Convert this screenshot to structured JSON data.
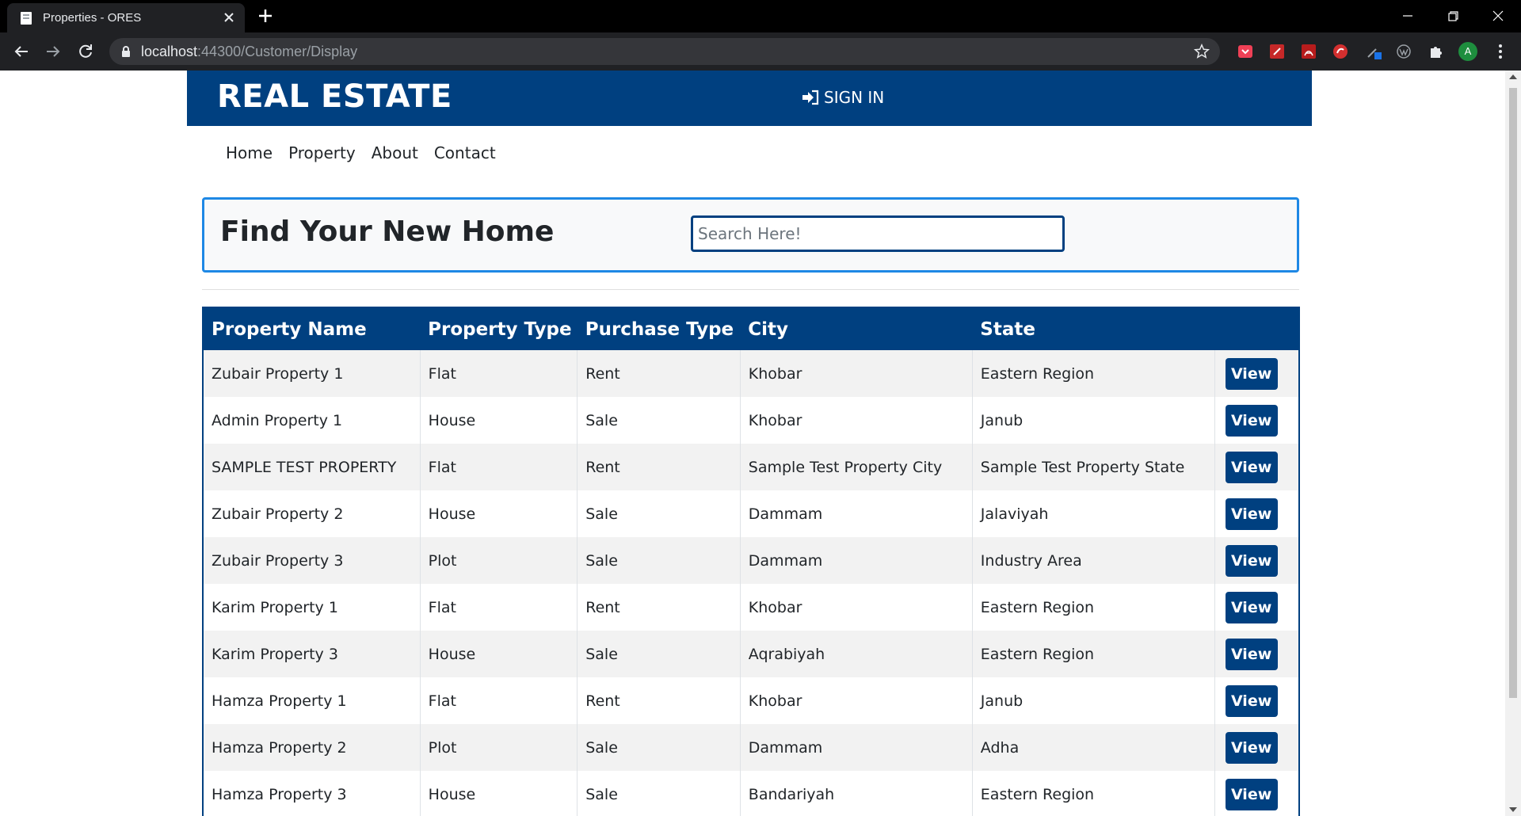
{
  "browser": {
    "tab_title": "Properties - ORES",
    "url_host": "localhost",
    "url_path": ":44300/Customer/Display",
    "profile_initial": "A"
  },
  "header": {
    "brand": "REAL ESTATE",
    "signin_label": "SIGN IN"
  },
  "nav": {
    "home": "Home",
    "property": "Property",
    "about": "About",
    "contact": "Contact"
  },
  "search": {
    "title": "Find Your New Home",
    "placeholder": "Search Here!"
  },
  "table": {
    "headers": [
      "Property Name",
      "Property Type",
      "Purchase Type",
      "City",
      "State",
      ""
    ],
    "action_label": "View",
    "rows": [
      [
        "Zubair Property 1",
        "Flat",
        "Rent",
        "Khobar",
        "Eastern Region"
      ],
      [
        "Admin Property 1",
        "House",
        "Sale",
        "Khobar",
        "Janub"
      ],
      [
        "SAMPLE TEST PROPERTY",
        "Flat",
        "Rent",
        "Sample Test Property City",
        "Sample Test Property State"
      ],
      [
        "Zubair Property 2",
        "House",
        "Sale",
        "Dammam",
        "Jalaviyah"
      ],
      [
        "Zubair Property 3",
        "Plot",
        "Sale",
        "Dammam",
        "Industry Area"
      ],
      [
        "Karim Property 1",
        "Flat",
        "Rent",
        "Khobar",
        "Eastern Region"
      ],
      [
        "Karim Property 3",
        "House",
        "Sale",
        "Aqrabiyah",
        "Eastern Region"
      ],
      [
        "Hamza Property 1",
        "Flat",
        "Rent",
        "Khobar",
        "Janub"
      ],
      [
        "Hamza Property 2",
        "Plot",
        "Sale",
        "Dammam",
        "Adha"
      ],
      [
        "Hamza Property 3",
        "House",
        "Sale",
        "Bandariyah",
        "Eastern Region"
      ]
    ]
  },
  "colors": {
    "brand_navy": "#004080",
    "search_border": "#1e88e5"
  }
}
